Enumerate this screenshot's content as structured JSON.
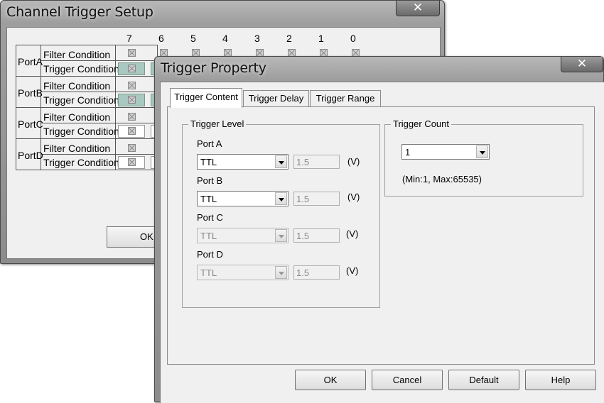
{
  "back_window": {
    "title": "Channel Trigger Setup",
    "close_glyph": "✕",
    "bit_headers": [
      "7",
      "6",
      "5",
      "4",
      "3",
      "2",
      "1",
      "0"
    ],
    "ports": [
      {
        "label": "PortA",
        "filter_label": "Filter Condition",
        "trigger_label": "Trigger Condition"
      },
      {
        "label": "PortB",
        "filter_label": "Filter Condition",
        "trigger_label": "Trigger Condition"
      },
      {
        "label": "PortC",
        "filter_label": "Filter Condition",
        "trigger_label": "Trigger Condition"
      },
      {
        "label": "PortD",
        "filter_label": "Filter Condition",
        "trigger_label": "Trigger Condition"
      }
    ],
    "ok_label": "OK"
  },
  "front_window": {
    "title": "Trigger Property",
    "close_glyph": "✕",
    "tabs": [
      {
        "label": "Trigger Content",
        "active": true
      },
      {
        "label": "Trigger Delay",
        "active": false
      },
      {
        "label": "Trigger Range",
        "active": false
      }
    ],
    "trigger_level": {
      "title": "Trigger Level",
      "ports": [
        {
          "label": "Port A",
          "type": "TTL",
          "level": "1.5",
          "unit": "(V)",
          "enabled": true
        },
        {
          "label": "Port B",
          "type": "TTL",
          "level": "1.5",
          "unit": "(V)",
          "enabled": true
        },
        {
          "label": "Port C",
          "type": "TTL",
          "level": "1.5",
          "unit": "(V)",
          "enabled": false
        },
        {
          "label": "Port D",
          "type": "TTL",
          "level": "1.5",
          "unit": "(V)",
          "enabled": false
        }
      ]
    },
    "trigger_count": {
      "title": "Trigger Count",
      "value": "1",
      "hint": "(Min:1, Max:65535)"
    },
    "buttons": {
      "ok": "OK",
      "cancel": "Cancel",
      "default": "Default",
      "help": "Help"
    }
  },
  "colors": {
    "title_bar": "#9e9e9e",
    "dialog_bg": "#f0f0f0",
    "selected_cell": "#a8c8c0"
  }
}
